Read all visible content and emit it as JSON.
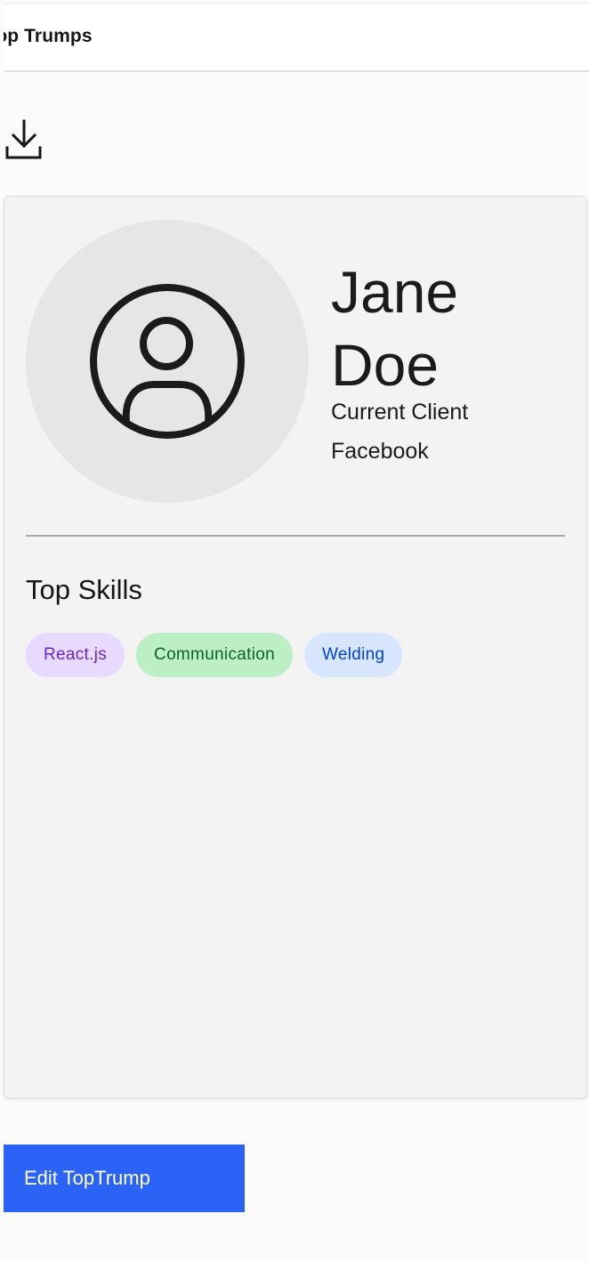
{
  "header": {
    "title": "Top Trumps"
  },
  "actions": {
    "download_icon": "download-icon"
  },
  "card": {
    "avatar_icon": "user-avatar-icon",
    "first_name": "Jane",
    "last_name": "Doe",
    "status": "Current Client",
    "company": "Facebook",
    "skills_title": "Top Skills",
    "skills": [
      {
        "label": "React.js",
        "color": "#e8daff",
        "text_color": "#6929c4"
      },
      {
        "label": "Communication",
        "color": "#bcf0c4",
        "text_color": "#0e6027"
      },
      {
        "label": "Welding",
        "color": "#d8e5ff",
        "text_color": "#0043ce"
      }
    ]
  },
  "footer": {
    "edit_label": "Edit TopTrump",
    "edit_color": "#2b63f6"
  }
}
